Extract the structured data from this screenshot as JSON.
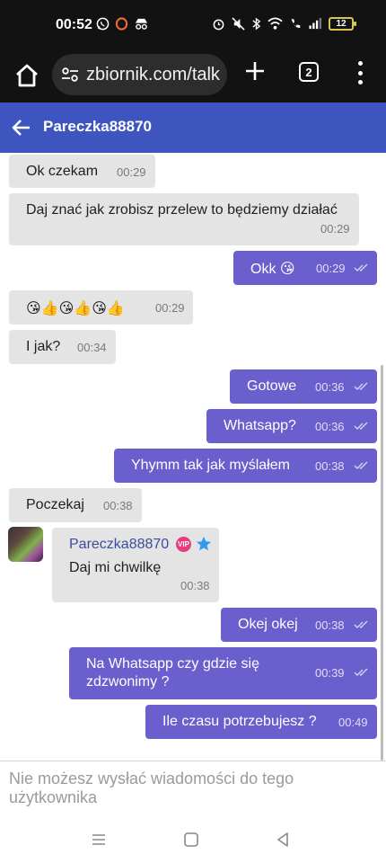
{
  "status": {
    "time": "00:52",
    "battery": "12",
    "left_icons": [
      "whatsapp-icon",
      "opera-icon",
      "incognito-icon"
    ],
    "right_icons": [
      "alarm-icon",
      "mute-icon",
      "bluetooth-icon",
      "wifi-icon",
      "call-icon",
      "signal-icon"
    ]
  },
  "browser": {
    "url": "zbiornik.com/talk",
    "tab_count": "2"
  },
  "chat": {
    "title": "Pareczka88870",
    "messages": [
      {
        "dir": "in",
        "text": "Ok czekam",
        "time": "00:29"
      },
      {
        "dir": "in",
        "text": "Daj znać jak zrobisz przelew to będziemy działać",
        "time": "00:29"
      },
      {
        "dir": "out",
        "text": "Okk 😘",
        "time": "00:29"
      },
      {
        "dir": "in",
        "text": "😘👍😘👍😘👍",
        "time": "00:29"
      },
      {
        "dir": "in",
        "text": "I jak?",
        "time": "00:34"
      },
      {
        "dir": "out",
        "text": "Gotowe",
        "time": "00:36"
      },
      {
        "dir": "out",
        "text": "Whatsapp?",
        "time": "00:36"
      },
      {
        "dir": "out",
        "text": "Yhymm tak jak myślałem",
        "time": "00:38"
      },
      {
        "dir": "in",
        "text": "Poczekaj",
        "time": "00:38"
      },
      {
        "dir": "in",
        "sender": "Pareczka88870",
        "badge": "VIP",
        "text": "Daj mi chwilkę",
        "time": "00:38"
      },
      {
        "dir": "out",
        "text": "Okej okej",
        "time": "00:38"
      },
      {
        "dir": "out",
        "text": "Na Whatsapp czy gdzie się",
        "text2": "zdzwonimy ?",
        "time": "00:39"
      },
      {
        "dir": "out",
        "text": "Ile czasu potrzebujesz ?",
        "time": "00:49"
      }
    ]
  },
  "composer": {
    "notice": "Nie możesz wysłać wiadomości do tego użytkownika"
  },
  "colors": {
    "header": "#3e55c0",
    "outgoing_bubble": "#6a5fcc",
    "incoming_bubble": "#e4e4e4"
  }
}
